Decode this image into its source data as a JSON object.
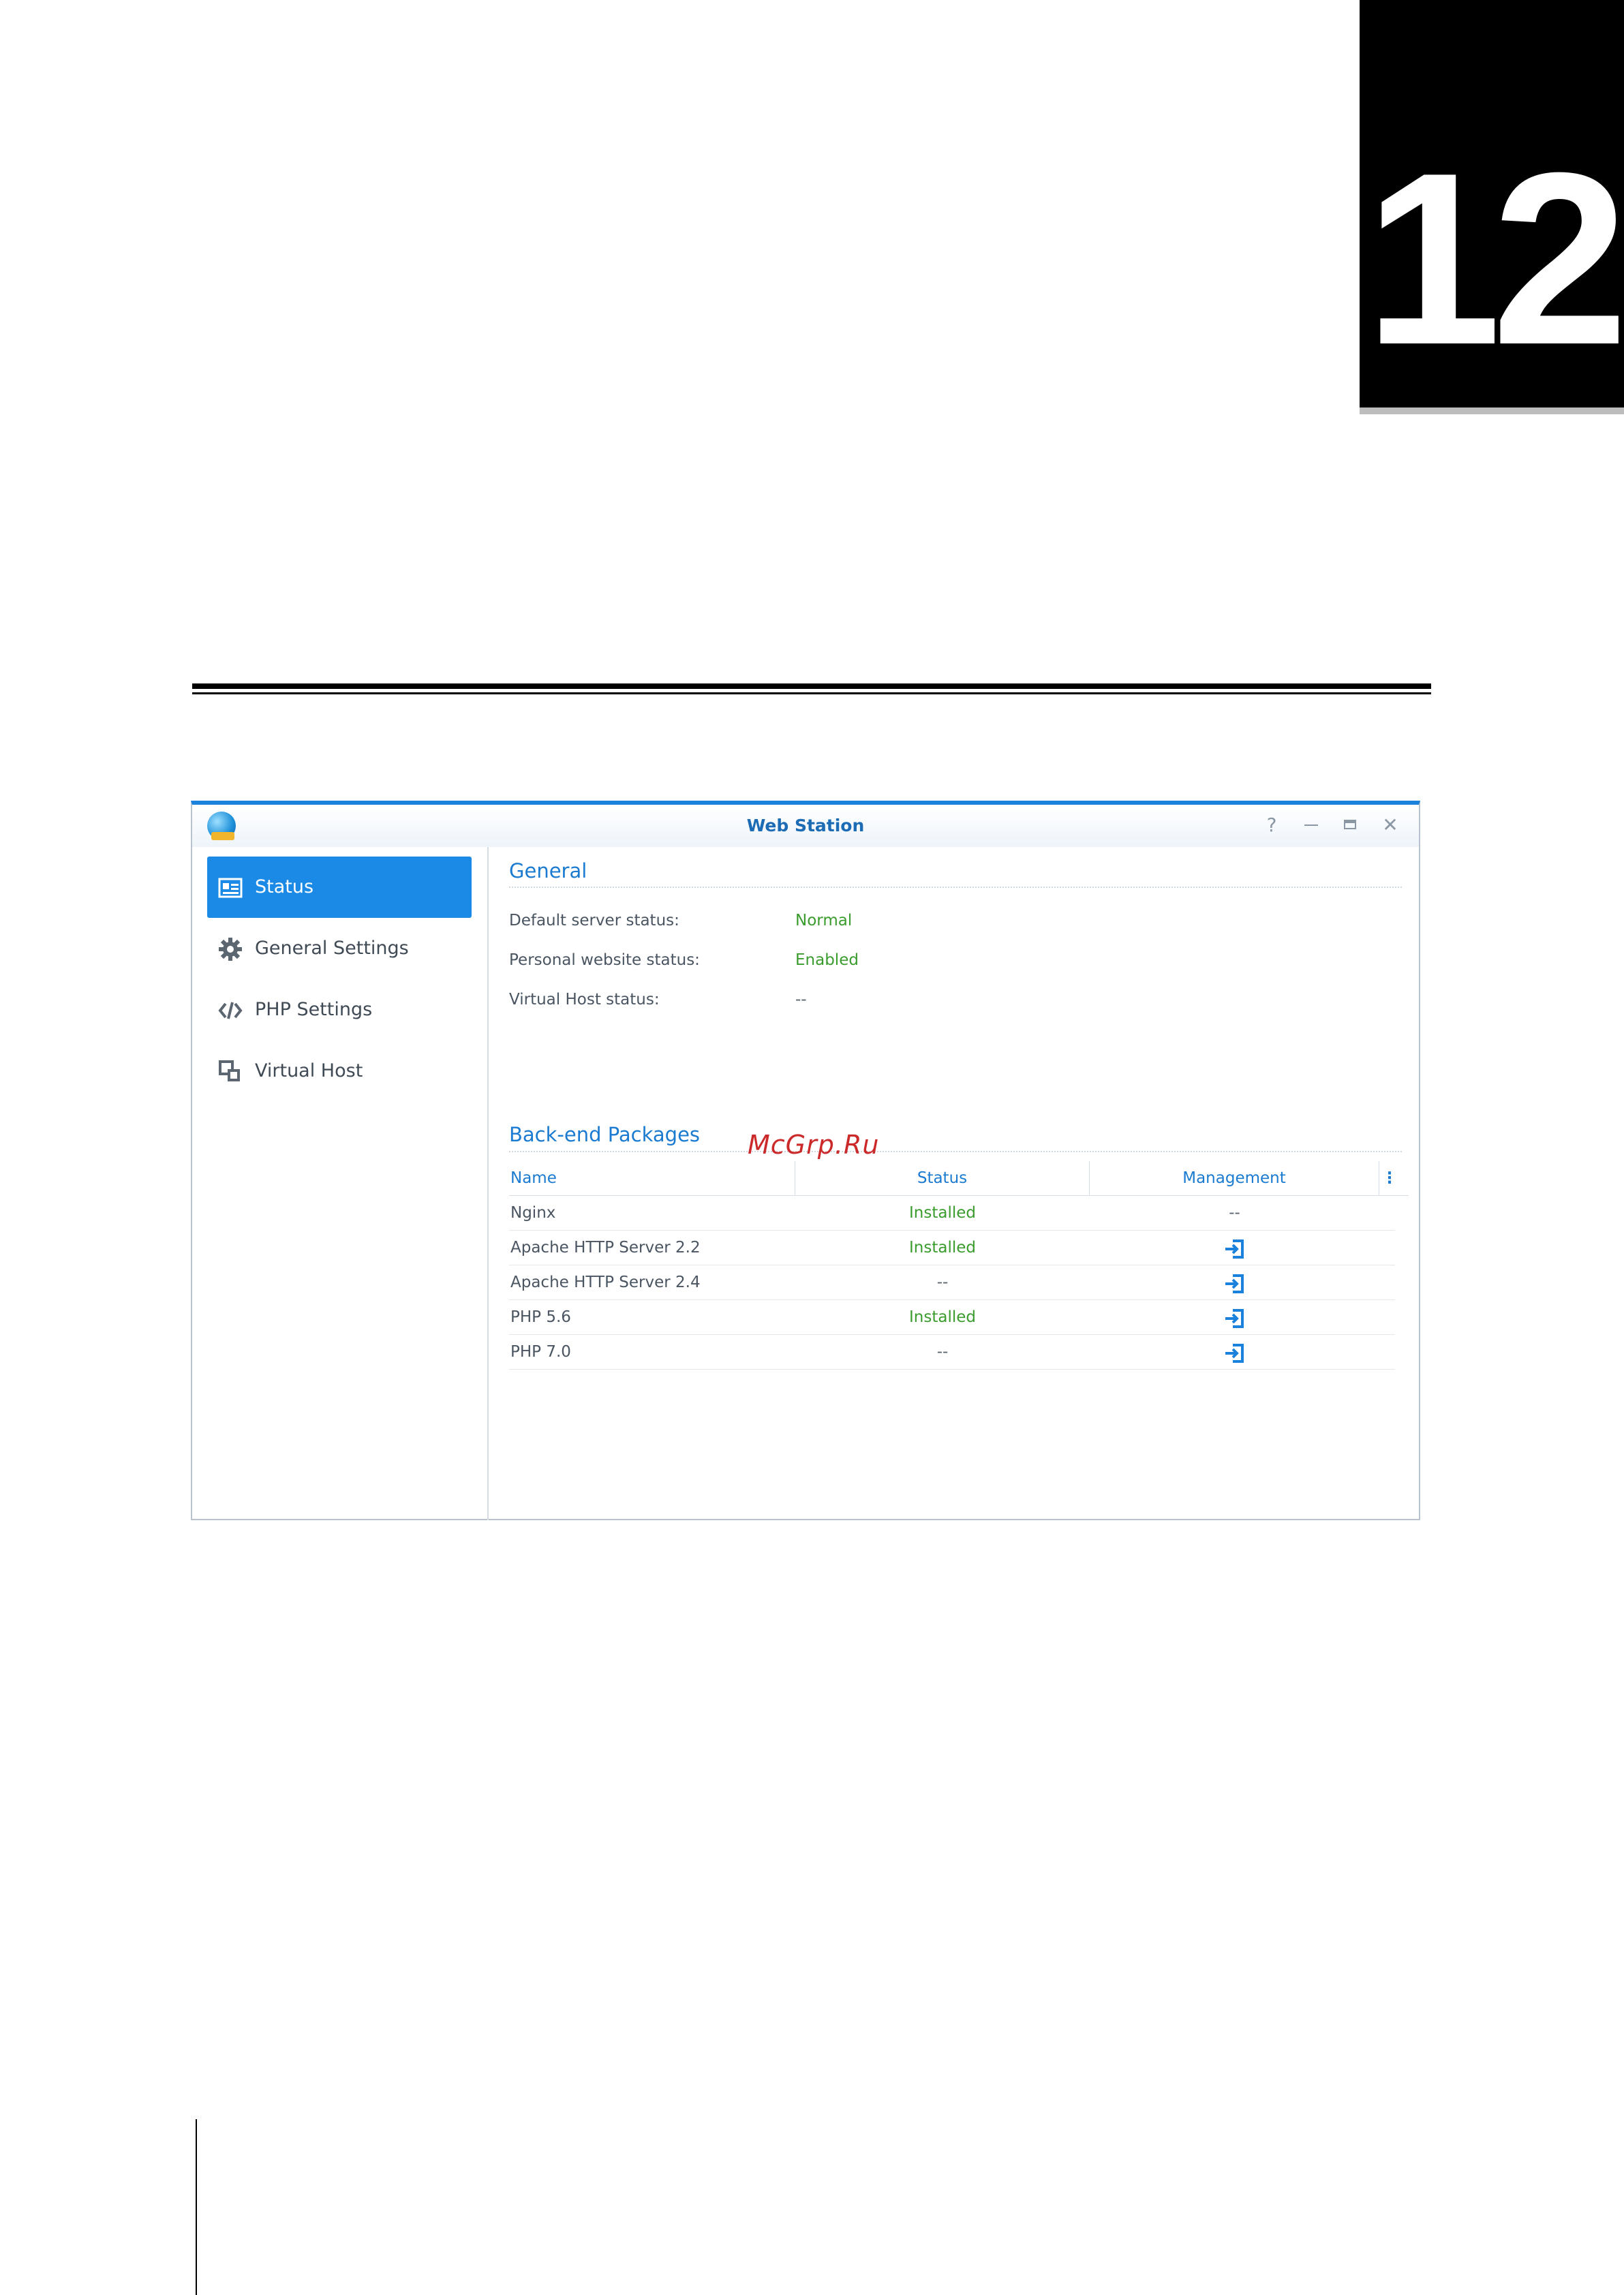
{
  "chapter": {
    "number": "12"
  },
  "window": {
    "title": "Web Station",
    "controls": {
      "help": "?",
      "close": "✕"
    }
  },
  "sidebar": {
    "items": [
      {
        "label": "Status",
        "icon": "status-card-icon",
        "active": true
      },
      {
        "label": "General Settings",
        "icon": "gear-icon",
        "active": false
      },
      {
        "label": "PHP Settings",
        "icon": "code-icon",
        "active": false
      },
      {
        "label": "Virtual Host",
        "icon": "virtual-host-icon",
        "active": false
      }
    ]
  },
  "general": {
    "title": "General",
    "fields": [
      {
        "label": "Default server status:",
        "value": "Normal"
      },
      {
        "label": "Personal website status:",
        "value": "Enabled"
      },
      {
        "label": "Virtual Host status:",
        "value": "--"
      }
    ]
  },
  "backend": {
    "title": "Back-end Packages",
    "columns": {
      "name": "Name",
      "status": "Status",
      "management": "Management",
      "more": "⋮"
    },
    "rows": [
      {
        "name": "Nginx",
        "status": "Installed",
        "management": "--"
      },
      {
        "name": "Apache HTTP Server 2.2",
        "status": "Installed",
        "management": "open-icon"
      },
      {
        "name": "Apache HTTP Server 2.4",
        "status": "--",
        "management": "open-icon"
      },
      {
        "name": "PHP 5.6",
        "status": "Installed",
        "management": "open-icon"
      },
      {
        "name": "PHP 7.0",
        "status": "--",
        "management": "open-icon"
      }
    ]
  },
  "watermark": "McGrp.Ru",
  "colors": {
    "accent": "#1a8ae6",
    "installed": "#3a9c2d"
  }
}
